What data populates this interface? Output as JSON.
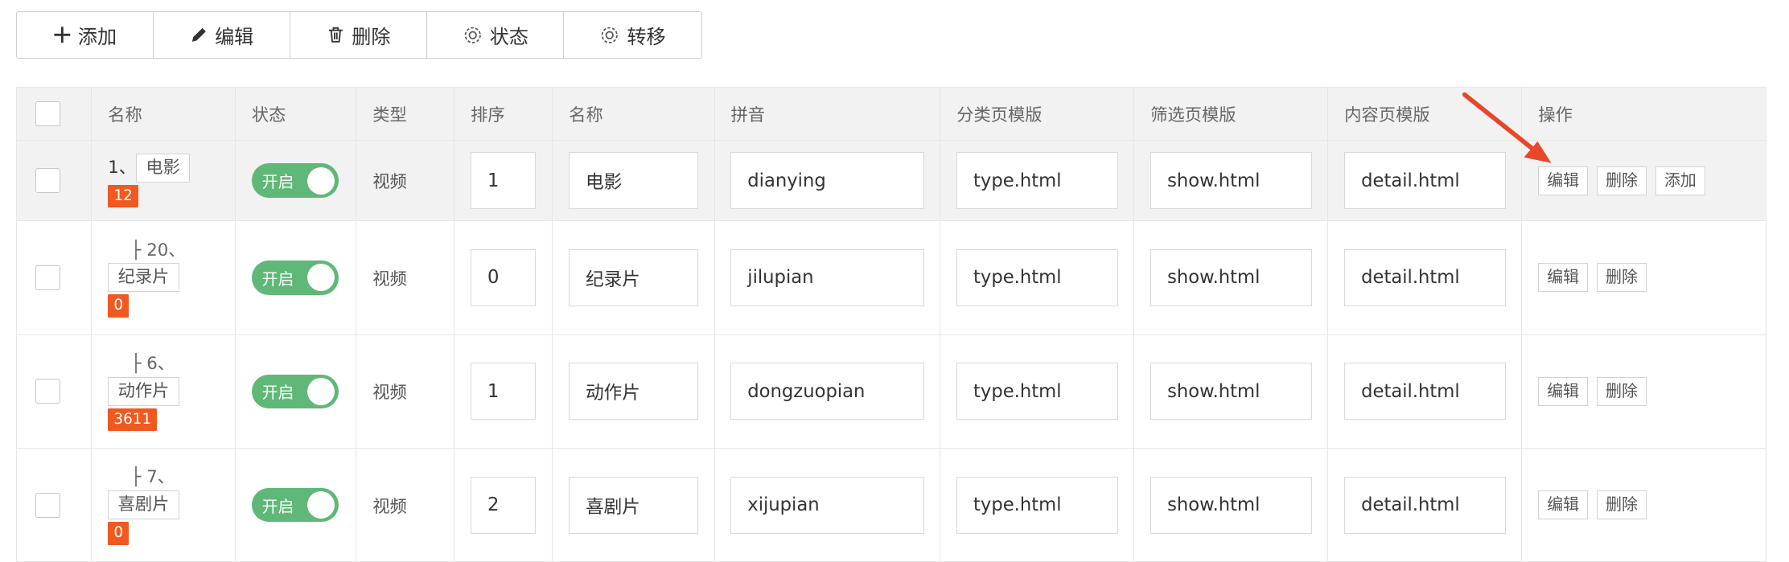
{
  "toolbar": {
    "add_label": "添加",
    "edit_label": "编辑",
    "delete_label": "删除",
    "status_label": "状态",
    "transfer_label": "转移"
  },
  "table": {
    "headers": {
      "name": "名称",
      "status": "状态",
      "type": "类型",
      "sort": "排序",
      "name2": "名称",
      "pinyin": "拼音",
      "category_tpl": "分类页模版",
      "filter_tpl": "筛选页模版",
      "content_tpl": "内容页模版",
      "actions": "操作"
    },
    "rows": [
      {
        "prefix": "1、",
        "name": "电影",
        "count": "12",
        "status": "开启",
        "type": "视频",
        "sort": "1",
        "name_input": "电影",
        "pinyin": "dianying",
        "category_tpl": "type.html",
        "filter_tpl": "show.html",
        "content_tpl": "detail.html",
        "edit": "编辑",
        "delete": "删除",
        "add": "添加"
      },
      {
        "prefix": "├ 20、",
        "name": "纪录片",
        "count": "0",
        "status": "开启",
        "type": "视频",
        "sort": "0",
        "name_input": "纪录片",
        "pinyin": "jilupian",
        "category_tpl": "type.html",
        "filter_tpl": "show.html",
        "content_tpl": "detail.html",
        "edit": "编辑",
        "delete": "删除"
      },
      {
        "prefix": "├ 6、",
        "name": "动作片",
        "count": "3611",
        "status": "开启",
        "type": "视频",
        "sort": "1",
        "name_input": "动作片",
        "pinyin": "dongzuopian",
        "category_tpl": "type.html",
        "filter_tpl": "show.html",
        "content_tpl": "detail.html",
        "edit": "编辑",
        "delete": "删除"
      },
      {
        "prefix": "├ 7、",
        "name": "喜剧片",
        "count": "0",
        "status": "开启",
        "type": "视频",
        "sort": "2",
        "name_input": "喜剧片",
        "pinyin": "xijupian",
        "category_tpl": "type.html",
        "filter_tpl": "show.html",
        "content_tpl": "detail.html",
        "edit": "编辑",
        "delete": "删除"
      }
    ]
  },
  "colors": {
    "switch_on": "#5fb878",
    "count_badge": "#f0591f",
    "annotation_arrow": "#e8472a"
  }
}
